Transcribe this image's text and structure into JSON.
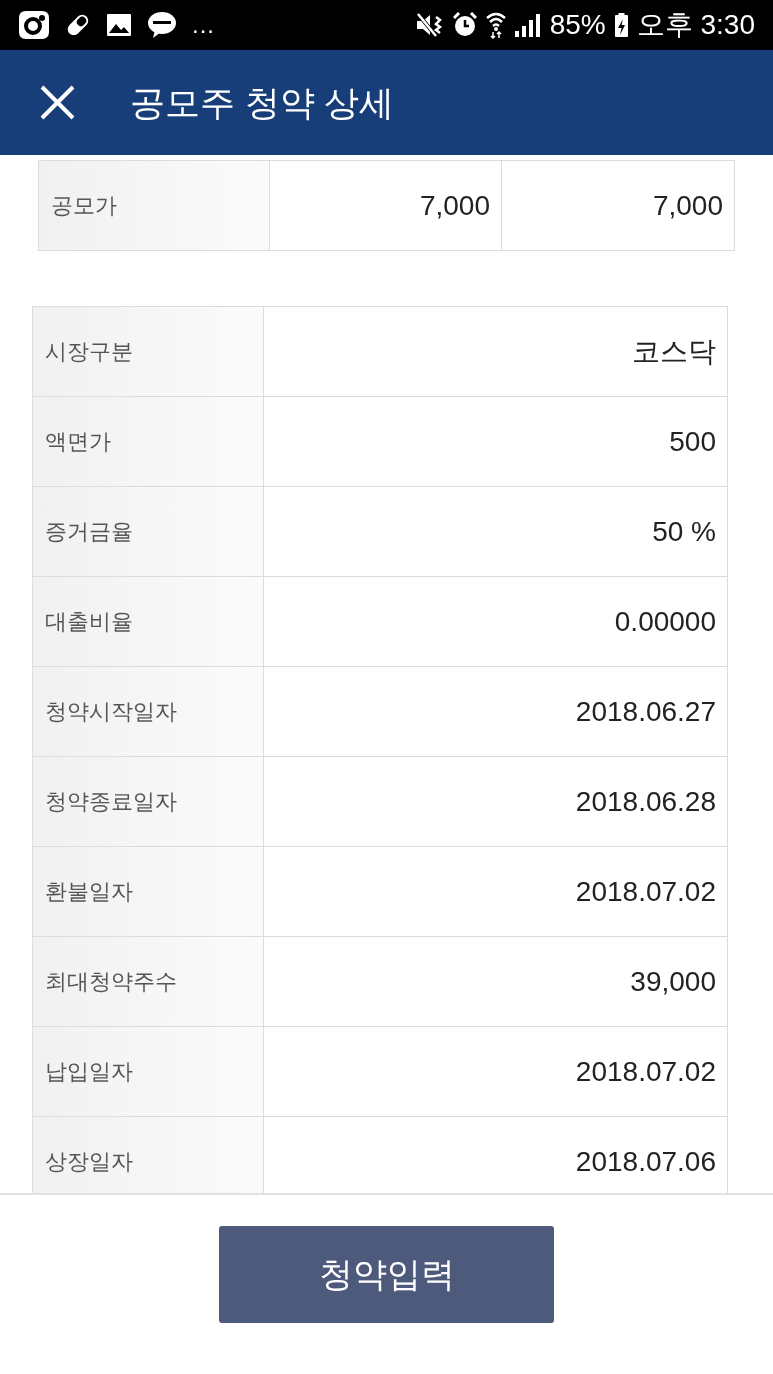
{
  "status_bar": {
    "overflow": "...",
    "battery": "85%",
    "charging": true,
    "time": "오후 3:30"
  },
  "header": {
    "title": "공모주 청약 상세"
  },
  "price_table": {
    "rows": [
      {
        "label": "공모가",
        "values": [
          "7,000",
          "7,000"
        ]
      }
    ]
  },
  "details": {
    "rows": [
      {
        "label": "시장구분",
        "value": "코스닥"
      },
      {
        "label": "액면가",
        "value": "500"
      },
      {
        "label": "증거금율",
        "value": "50 %"
      },
      {
        "label": "대출비율",
        "value": "0.00000"
      },
      {
        "label": "청약시작일자",
        "value": "2018.06.27"
      },
      {
        "label": "청약종료일자",
        "value": "2018.06.28"
      },
      {
        "label": "환불일자",
        "value": "2018.07.02"
      },
      {
        "label": "최대청약주수",
        "value": "39,000"
      },
      {
        "label": "납입일자",
        "value": "2018.07.02"
      },
      {
        "label": "상장일자",
        "value": "2018.07.06"
      }
    ]
  },
  "action_button": {
    "label": "청약입력"
  }
}
